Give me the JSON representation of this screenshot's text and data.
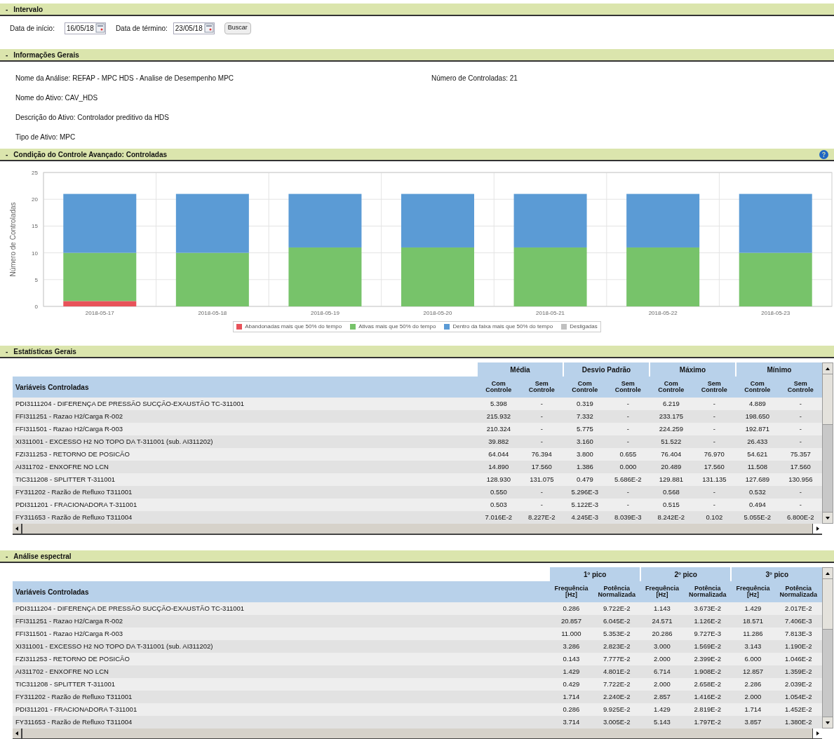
{
  "interval": {
    "toggle": "-",
    "title": "Intervalo",
    "start_label": "Data de início:",
    "start_value": "16/05/18",
    "end_label": "Data de término:",
    "end_value": "23/05/18",
    "search_button": "Buscar"
  },
  "general_info": {
    "toggle": "-",
    "title": "Informações Gerais",
    "fields": [
      "Nome da Análise: REFAP - MPC HDS - Analise de Desempenho MPC",
      "Nome do Ativo: CAV_HDS",
      "Descrição do Ativo: Controlador preditivo da HDS",
      "Tipo de Ativo: MPC"
    ],
    "count": "Número de Controladas: 21"
  },
  "condition": {
    "toggle": "-",
    "title": "Condição do Controle Avançado: Controladas",
    "chart_data": {
      "type": "bar",
      "stacked": true,
      "grid": true,
      "legend": true,
      "ylabel": "Número de Controladas",
      "categories": [
        "2018-05-17",
        "2018-05-18",
        "2018-05-19",
        "2018-05-20",
        "2018-05-21",
        "2018-05-22",
        "2018-05-23"
      ],
      "ylim": [
        0,
        25
      ],
      "yticks": [
        0,
        5,
        10,
        15,
        20,
        25
      ],
      "series": [
        {
          "name": "Abandonadas mais que 50% do tempo",
          "color": "#e8525a",
          "values": [
            1,
            0,
            0,
            0,
            0,
            0,
            0
          ]
        },
        {
          "name": "Ativas mais que 50% do tempo",
          "color": "#77c36a",
          "values": [
            9,
            10,
            11,
            11,
            11,
            11,
            10
          ]
        },
        {
          "name": "Dentro da faixa mais que 50% do tempo",
          "color": "#5b9bd5",
          "values": [
            11,
            11,
            10,
            10,
            10,
            10,
            11
          ]
        },
        {
          "name": "Desligadas",
          "color": "#c0c0c0",
          "values": [
            0,
            0,
            0,
            0,
            0,
            0,
            0
          ]
        }
      ]
    }
  },
  "statistics": {
    "toggle": "-",
    "title": "Estatísticas Gerais",
    "row_header": "Variáveis Controladas",
    "groups": [
      {
        "label": "Média",
        "columns": [
          "Com Controle",
          "Sem Controle"
        ]
      },
      {
        "label": "Desvio Padrão",
        "columns": [
          "Com Controle",
          "Sem Controle"
        ]
      },
      {
        "label": "Máximo",
        "columns": [
          "Com Controle",
          "Sem Controle"
        ]
      },
      {
        "label": "Mínimo",
        "columns": [
          "Com Controle",
          "Sem Controle"
        ]
      }
    ],
    "rows": [
      {
        "name": "PDI3111204 - DIFERENÇA DE PRESSÃO SUCÇÃO-EXAUSTÃO TC-311001",
        "values": [
          "5.398",
          "-",
          "0.319",
          "-",
          "6.219",
          "-",
          "4.889",
          "-"
        ]
      },
      {
        "name": "FFI311251 - Razao H2/Carga R-002",
        "values": [
          "215.932",
          "-",
          "7.332",
          "-",
          "233.175",
          "-",
          "198.650",
          "-"
        ]
      },
      {
        "name": "FFI311501 - Razao H2/Carga R-003",
        "values": [
          "210.324",
          "-",
          "5.775",
          "-",
          "224.259",
          "-",
          "192.871",
          "-"
        ]
      },
      {
        "name": "XI311001 - EXCESSO H2 NO TOPO DA T-311001 (sub. AI311202)",
        "values": [
          "39.882",
          "-",
          "3.160",
          "-",
          "51.522",
          "-",
          "26.433",
          "-"
        ]
      },
      {
        "name": "FZI311253 - RETORNO DE POSICÃO",
        "values": [
          "64.044",
          "76.394",
          "3.800",
          "0.655",
          "76.404",
          "76.970",
          "54.621",
          "75.357"
        ]
      },
      {
        "name": "AI311702 - ENXOFRE NO LCN",
        "values": [
          "14.890",
          "17.560",
          "1.386",
          "0.000",
          "20.489",
          "17.560",
          "11.508",
          "17.560"
        ]
      },
      {
        "name": "TIC311208 - SPLITTER T-311001",
        "values": [
          "128.930",
          "131.075",
          "0.479",
          "5.686E-2",
          "129.881",
          "131.135",
          "127.689",
          "130.956"
        ]
      },
      {
        "name": "FY311202 - Razão de Refluxo T311001",
        "values": [
          "0.550",
          "-",
          "5.296E-3",
          "-",
          "0.568",
          "-",
          "0.532",
          "-"
        ]
      },
      {
        "name": "PDI311201 - FRACIONADORA T-311001",
        "values": [
          "0.503",
          "-",
          "5.122E-3",
          "-",
          "0.515",
          "-",
          "0.494",
          "-"
        ]
      },
      {
        "name": "FY311653 - Razão de Refluxo T311004",
        "values": [
          "7.016E-2",
          "8.227E-2",
          "4.245E-3",
          "8.039E-3",
          "8.242E-2",
          "0.102",
          "5.055E-2",
          "6.800E-2"
        ]
      }
    ]
  },
  "spectral": {
    "toggle": "-",
    "title": "Análise espectral",
    "row_header": "Variáveis Controladas",
    "groups": [
      {
        "label": "1º pico",
        "columns": [
          "Frequência [Hz]",
          "Potência Normalizada"
        ]
      },
      {
        "label": "2º pico",
        "columns": [
          "Frequência [Hz]",
          "Potência Normalizada"
        ]
      },
      {
        "label": "3º pico",
        "columns": [
          "Frequência [Hz]",
          "Potência Normalizada"
        ]
      }
    ],
    "rows": [
      {
        "name": "PDI3111204 - DIFERENÇA DE PRESSÃO SUCÇÃO-EXAUSTÃO TC-311001",
        "values": [
          "0.286",
          "9.722E-2",
          "1.143",
          "3.673E-2",
          "1.429",
          "2.017E-2"
        ]
      },
      {
        "name": "FFI311251 - Razao H2/Carga R-002",
        "values": [
          "20.857",
          "6.045E-2",
          "24.571",
          "1.126E-2",
          "18.571",
          "7.406E-3"
        ]
      },
      {
        "name": "FFI311501 - Razao H2/Carga R-003",
        "values": [
          "11.000",
          "5.353E-2",
          "20.286",
          "9.727E-3",
          "11.286",
          "7.813E-3"
        ]
      },
      {
        "name": "XI311001 - EXCESSO H2 NO TOPO DA T-311001 (sub. AI311202)",
        "values": [
          "3.286",
          "2.823E-2",
          "3.000",
          "1.569E-2",
          "3.143",
          "1.190E-2"
        ]
      },
      {
        "name": "FZI311253 - RETORNO DE POSICÃO",
        "values": [
          "0.143",
          "7.777E-2",
          "2.000",
          "2.399E-2",
          "6.000",
          "1.046E-2"
        ]
      },
      {
        "name": "AI311702 - ENXOFRE NO LCN",
        "values": [
          "1.429",
          "4.801E-2",
          "6.714",
          "1.908E-2",
          "12.857",
          "1.359E-2"
        ]
      },
      {
        "name": "TIC311208 - SPLITTER T-311001",
        "values": [
          "0.429",
          "7.722E-2",
          "2.000",
          "2.658E-2",
          "2.286",
          "2.039E-2"
        ]
      },
      {
        "name": "FY311202 - Razão de Refluxo T311001",
        "values": [
          "1.714",
          "2.240E-2",
          "2.857",
          "1.416E-2",
          "2.000",
          "1.054E-2"
        ]
      },
      {
        "name": "PDI311201 - FRACIONADORA T-311001",
        "values": [
          "0.286",
          "9.925E-2",
          "1.429",
          "2.819E-2",
          "1.714",
          "1.452E-2"
        ]
      },
      {
        "name": "FY311653 - Razão de Refluxo T311004",
        "values": [
          "3.714",
          "3.005E-2",
          "5.143",
          "1.797E-2",
          "3.857",
          "1.380E-2"
        ]
      }
    ]
  }
}
